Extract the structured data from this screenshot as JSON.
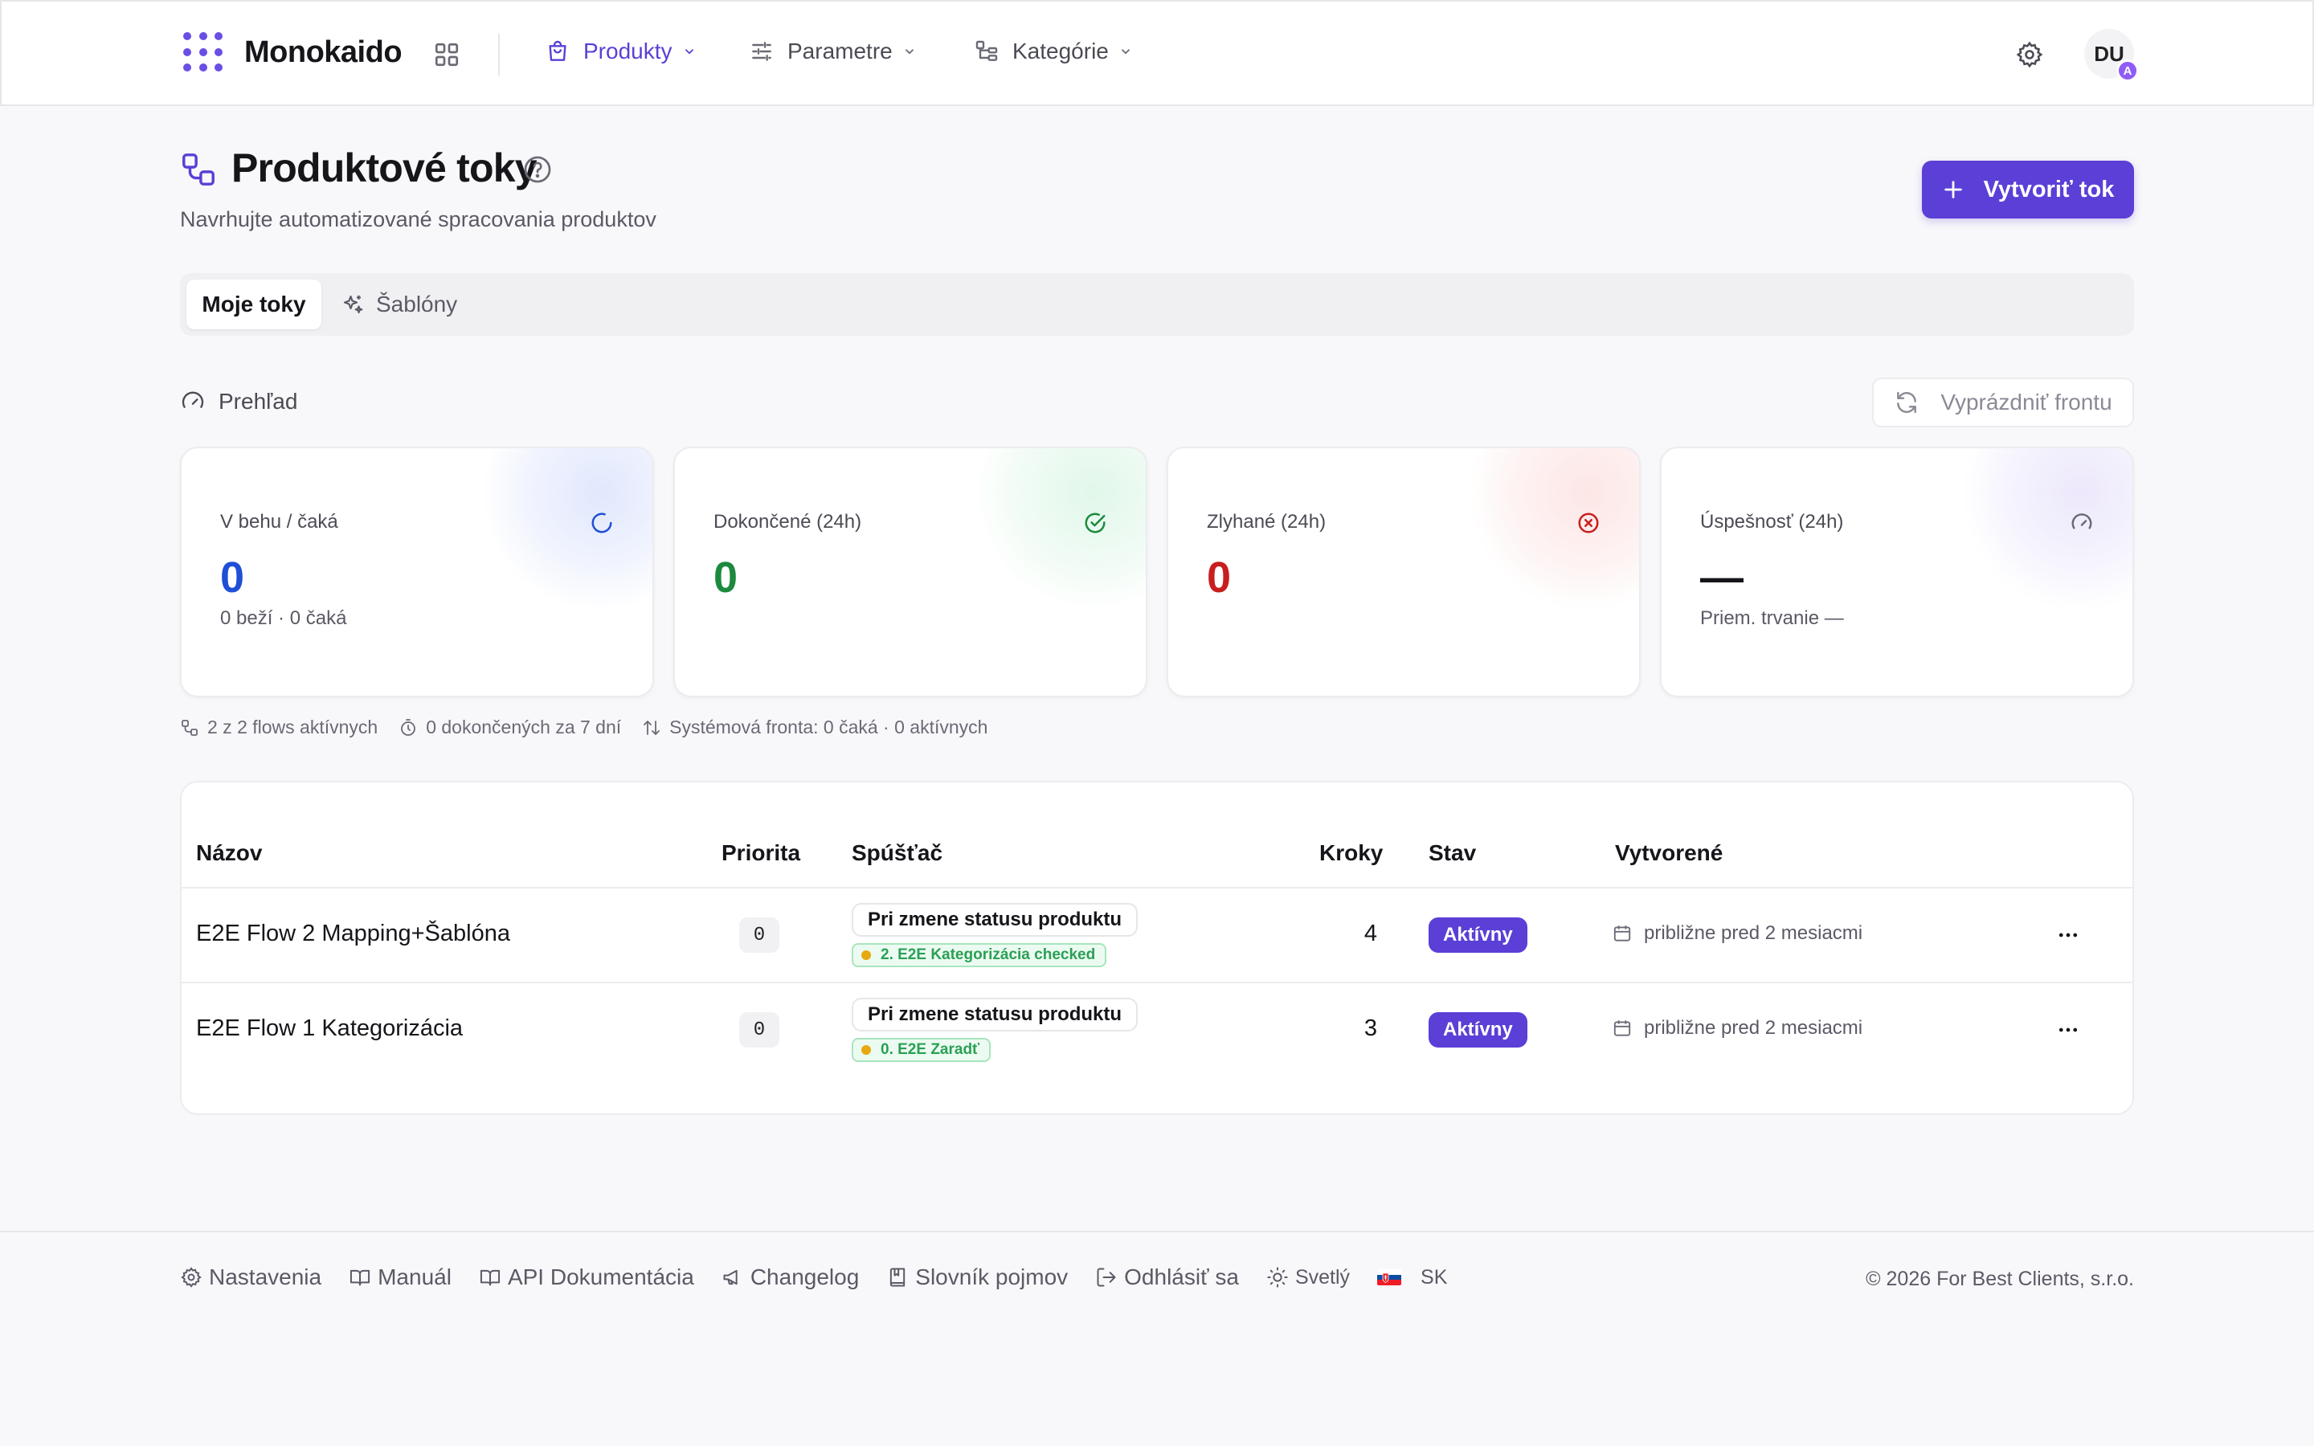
{
  "app": {
    "brand": "Monokaido"
  },
  "nav": {
    "items": [
      {
        "label": "Produkty"
      },
      {
        "label": "Parametre"
      },
      {
        "label": "Kategórie"
      }
    ],
    "avatar_initials": "DU",
    "avatar_badge": "A"
  },
  "header": {
    "title": "Produktové toky",
    "subtitle": "Navrhujte automatizované spracovania produktov",
    "create_label": "Vytvoriť tok"
  },
  "tabs": [
    {
      "label": "Moje toky"
    },
    {
      "label": "Šablóny"
    }
  ],
  "overview": {
    "label": "Prehľad",
    "flush_label": "Vyprázdniť frontu",
    "cards": [
      {
        "label": "V behu / čaká",
        "value": "0",
        "sub": "0 beží · 0 čaká",
        "color": "#1f4fd6"
      },
      {
        "label": "Dokončené (24h)",
        "value": "0",
        "sub": "",
        "color": "#1c8a3e"
      },
      {
        "label": "Zlyhané (24h)",
        "value": "0",
        "sub": "",
        "color": "#c81e1e"
      },
      {
        "label": "Úspešnosť (24h)",
        "value": "—",
        "sub": "Priem. trvanie —",
        "color": "#15151a"
      }
    ],
    "meta": [
      "2 z 2 flows aktívnych",
      "0 dokončených za 7 dní",
      "Systémová fronta: 0 čaká · 0 aktívnych"
    ]
  },
  "table": {
    "columns": [
      "Názov",
      "Priorita",
      "Spúšťač",
      "Kroky",
      "Stav",
      "Vytvorené"
    ],
    "rows": [
      {
        "name": "E2E Flow 2 Mapping+Šablóna",
        "priority": "0",
        "trigger": "Pri zmene statusu produktu",
        "trigger_status": "2. E2E Kategorizácia checked",
        "steps": "4",
        "status": "Aktívny",
        "created": "približne pred 2 mesiacmi"
      },
      {
        "name": "E2E Flow 1 Kategorizácia",
        "priority": "0",
        "trigger": "Pri zmene statusu produktu",
        "trigger_status": "0. E2E Zaradť",
        "steps": "3",
        "status": "Aktívny",
        "created": "približne pred 2 mesiacmi"
      }
    ]
  },
  "footer": {
    "links": [
      {
        "label": "Nastavenia"
      },
      {
        "label": "Manuál"
      },
      {
        "label": "API Dokumentácia"
      },
      {
        "label": "Changelog"
      },
      {
        "label": "Slovník pojmov"
      },
      {
        "label": "Odhlásiť sa"
      }
    ],
    "theme_label": "Svetlý",
    "language": "SK",
    "copyright": "© 2026 For Best Clients, s.r.o."
  },
  "colors": {
    "accent": "#5b3fd6",
    "success": "#1c8a3e",
    "danger": "#c81e1e",
    "info": "#1f4fd6"
  }
}
